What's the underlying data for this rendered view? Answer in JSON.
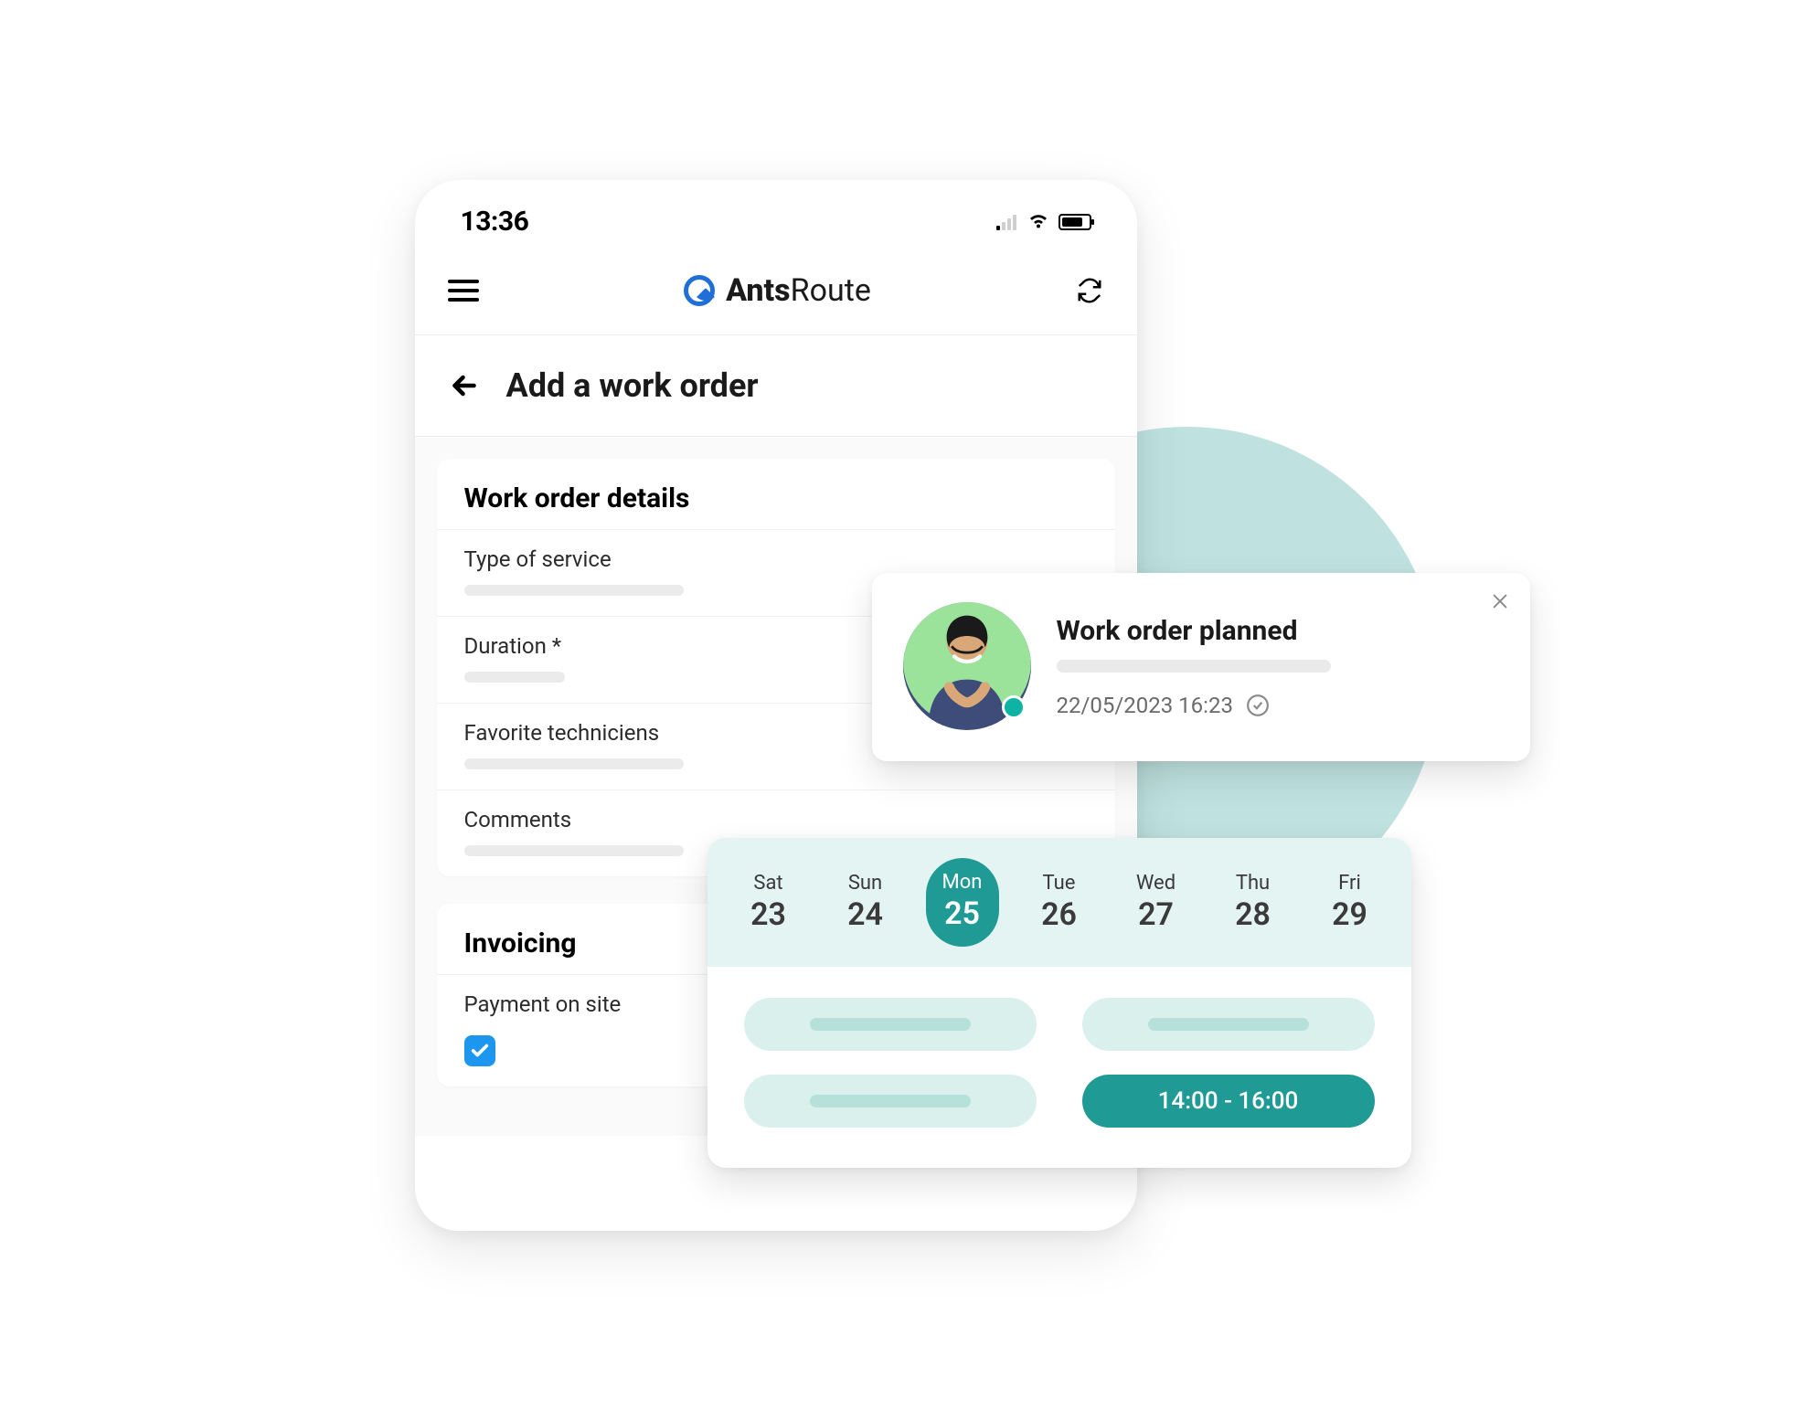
{
  "statusbar": {
    "time": "13:36"
  },
  "brand": {
    "bold": "Ants",
    "light": "Route"
  },
  "page": {
    "title": "Add a work order"
  },
  "details": {
    "title": "Work order details",
    "fields": {
      "type_label": "Type of service",
      "duration_label": "Duration *",
      "technicians_label": "Favorite techniciens",
      "comments_label": "Comments"
    }
  },
  "invoicing": {
    "title": "Invoicing",
    "payment_label": "Payment on site",
    "payment_checked": true
  },
  "notification": {
    "title": "Work order planned",
    "timestamp": "22/05/2023 16:23"
  },
  "scheduler": {
    "days": [
      {
        "dow": "Sat",
        "num": "23",
        "selected": false
      },
      {
        "dow": "Sun",
        "num": "24",
        "selected": false
      },
      {
        "dow": "Mon",
        "num": "25",
        "selected": true
      },
      {
        "dow": "Tue",
        "num": "26",
        "selected": false
      },
      {
        "dow": "Wed",
        "num": "27",
        "selected": false
      },
      {
        "dow": "Thu",
        "num": "28",
        "selected": false
      },
      {
        "dow": "Fri",
        "num": "29",
        "selected": false
      }
    ],
    "selected_slot_label": "14:00 - 16:00"
  }
}
